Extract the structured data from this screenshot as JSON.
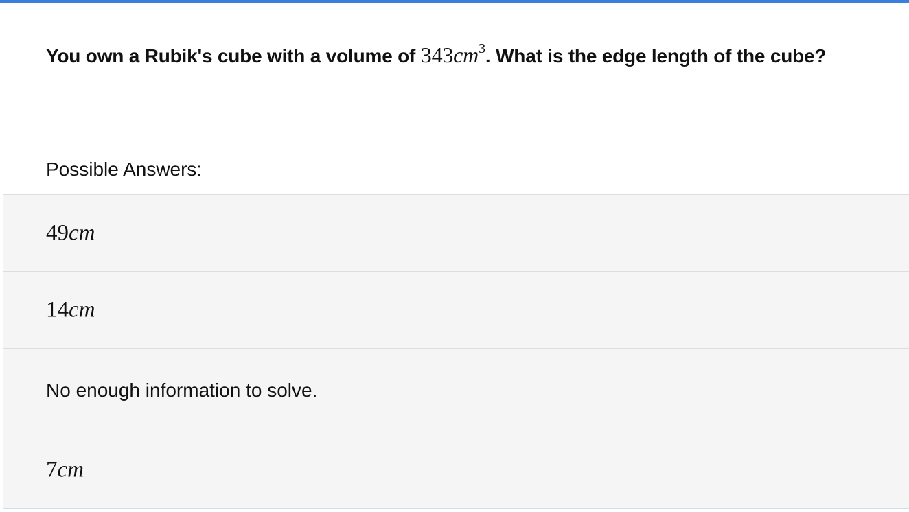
{
  "question": {
    "prefix": "You own a Rubik's cube with a volume of ",
    "math_number": "343",
    "math_unit": "cm",
    "math_exponent": "3",
    "suffix": ". What is the edge length of the cube?"
  },
  "possible_answers_label": "Possible Answers:",
  "answers": [
    {
      "number": "49",
      "unit": "cm"
    },
    {
      "number": "14",
      "unit": "cm"
    },
    {
      "text": "No enough information to solve."
    },
    {
      "number": "7",
      "unit": "cm"
    }
  ],
  "colors": {
    "accent": "#3b7fdd",
    "answer_bg": "#f5f5f5",
    "divider": "#dddddd"
  }
}
